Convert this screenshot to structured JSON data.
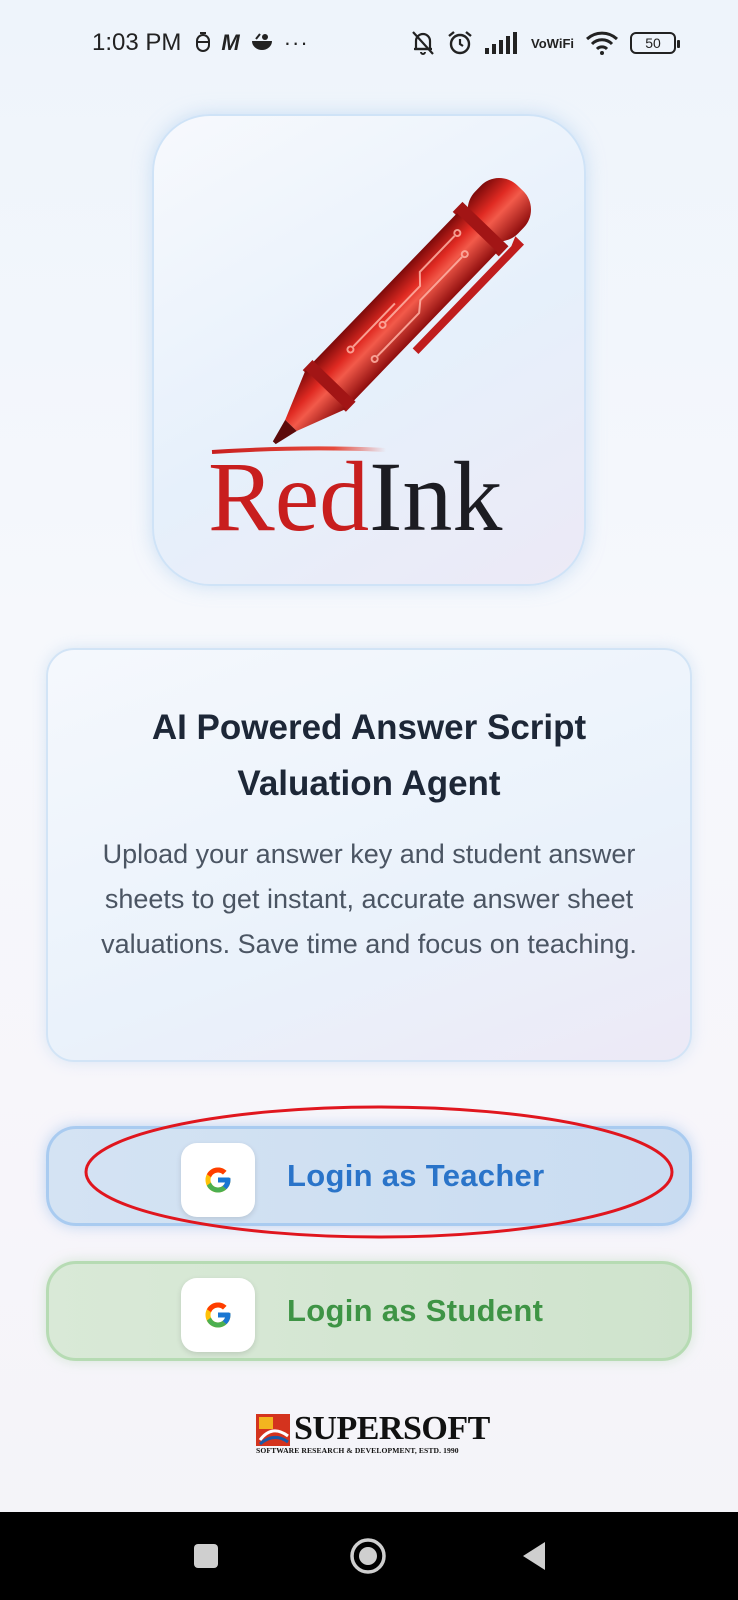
{
  "status_bar": {
    "time": "1:03 PM",
    "left_icons": [
      "notification-icon-1",
      "m-app-icon",
      "bowl-app-icon",
      "more-dots-icon"
    ],
    "more_glyph": "···",
    "m_glyph": "M",
    "right_icons": [
      "bell-muted-icon",
      "alarm-icon",
      "signal-icon",
      "vowifi-icon",
      "wifi-icon",
      "battery-icon"
    ],
    "vowifi_top": "Vo",
    "vowifi_bottom": "WiFi",
    "battery_level": "50"
  },
  "logo": {
    "brand_part1": "Red",
    "brand_part2": "Ink",
    "brand_part1_color": "#c81e1e",
    "brand_part2_color": "#1c1c22"
  },
  "info_card": {
    "title": "AI Powered Answer Script Valuation Agent",
    "description": "Upload your answer key and student answer sheets to get instant, accurate answer sheet valuations. Save time and focus on teaching."
  },
  "buttons": {
    "teacher_label": "Login as Teacher",
    "student_label": "Login as Student",
    "teacher_color": "#2a74c9",
    "student_color": "#3e9445"
  },
  "footer": {
    "brand": "SUPERSOFT",
    "tagline": "SOFTWARE RESEARCH & DEVELOPMENT, ESTD. 1990"
  },
  "annotation": {
    "highlight_color": "#e0161e"
  }
}
